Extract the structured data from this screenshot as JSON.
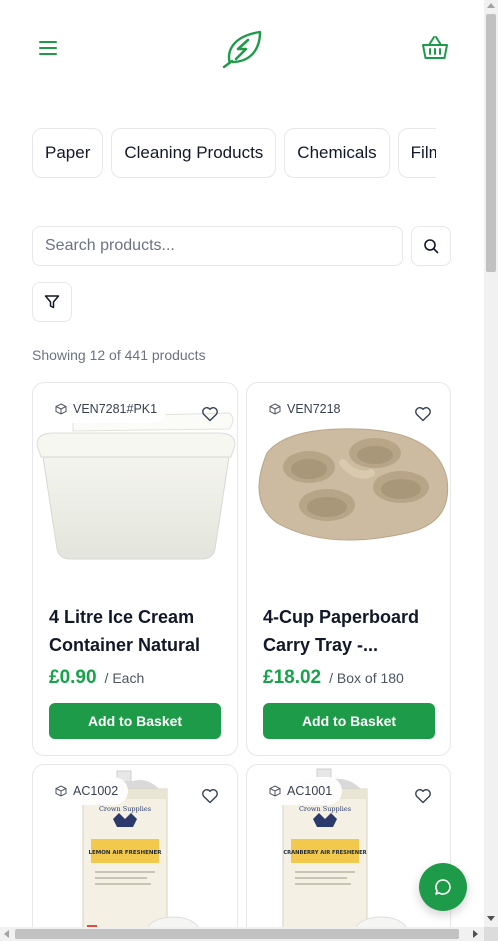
{
  "colors": {
    "brand": "#1e9b48",
    "price": "#16a34a",
    "border": "#e5e7eb"
  },
  "header": {
    "menu_icon": "hamburger-menu-icon",
    "logo_icon": "leaf-lightning-logo",
    "basket_icon": "shopping-basket-icon"
  },
  "categories": [
    {
      "label": "Paper"
    },
    {
      "label": "Cleaning Products"
    },
    {
      "label": "Chemicals"
    },
    {
      "label": "Film"
    }
  ],
  "search": {
    "placeholder": "Search products...",
    "value": "",
    "button_icon": "search-icon"
  },
  "filter": {
    "icon": "filter-icon"
  },
  "results": {
    "text": "Showing 12 of 441 products"
  },
  "products": [
    {
      "sku": "VEN7281#PK1",
      "title": "4 Litre Ice Cream Container Natural",
      "price": "£0.90",
      "unit": "/ Each",
      "button": "Add to Basket"
    },
    {
      "sku": "VEN7218",
      "title": "4-Cup Paperboard Carry Tray -...",
      "price": "£18.02",
      "unit": "/ Box of 180",
      "button": "Add to Basket"
    },
    {
      "sku": "AC1002",
      "title": "",
      "price": "",
      "unit": "",
      "button": "",
      "can_brand": "Crown Supplies",
      "can_label": "LEMON AIR FRESHENER"
    },
    {
      "sku": "AC1001",
      "title": "",
      "price": "",
      "unit": "",
      "button": "",
      "can_brand": "Crown Supplies",
      "can_label": "CRANBERRY AIR FRESHENER"
    }
  ],
  "chat": {
    "icon": "chat-bubble-icon"
  }
}
